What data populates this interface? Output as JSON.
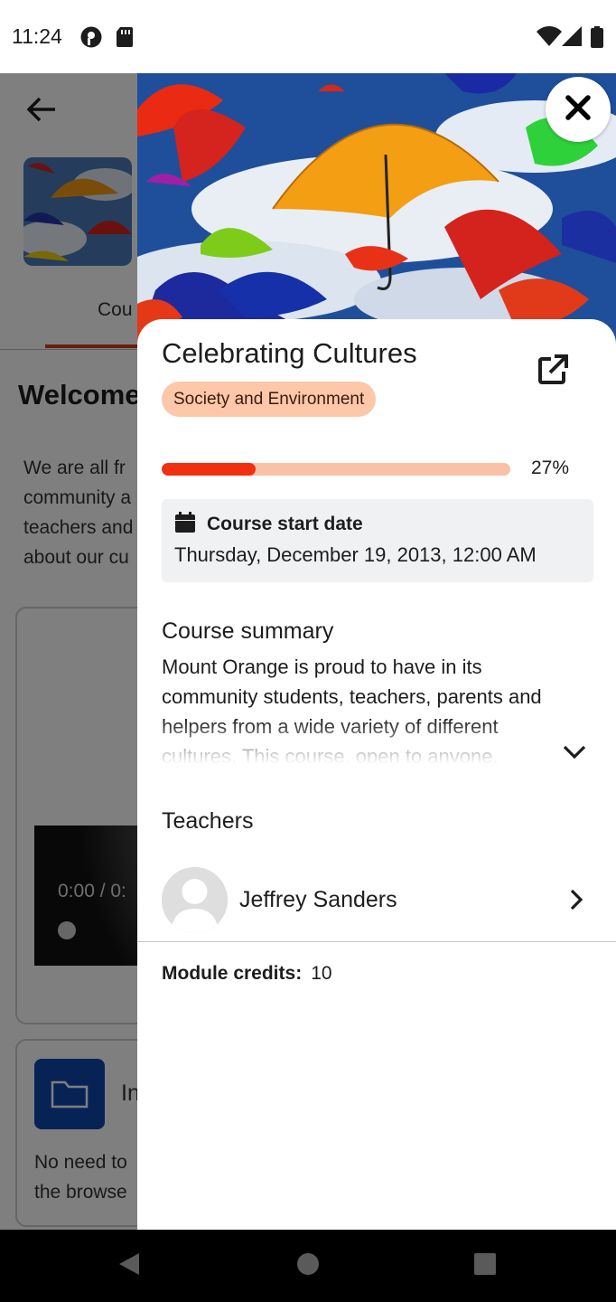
{
  "status_bar": {
    "time": "11:24",
    "left_icons": [
      "privacy-indicator-icon",
      "sd-card-icon"
    ],
    "right_icons": [
      "wifi-icon",
      "signal-icon",
      "battery-icon"
    ]
  },
  "background": {
    "tab_label": "Cou",
    "welcome_text": "Welcome",
    "intro_text": "We are all fr\ncommunity a\nteachers and\nabout our cu",
    "video_time": "0:00 / 0:",
    "card_title": "In",
    "card_text": "No need to\nthe browse"
  },
  "course": {
    "title": "Celebrating Cultures",
    "category": "Society and Environment",
    "progress_percent": 27,
    "progress_text": "27%",
    "start_date_label": "Course start date",
    "start_date_value": "Thursday, December 19, 2013, 12:00 AM",
    "summary_label": "Course summary",
    "summary_text": "Mount Orange is proud to have in its community students, teachers, parents and helpers from a wide variety of different cultures. This course, open to anyone,",
    "teachers_label": "Teachers",
    "teachers": [
      {
        "name": "Jeffrey Sanders"
      }
    ],
    "credits_label": "Module credits:",
    "credits_value": "10"
  },
  "colors": {
    "accent": "#f1300f",
    "progress_track": "#f9c1a6",
    "category_badge": "#fdc7a9",
    "start_box": "#f0f1f3"
  }
}
